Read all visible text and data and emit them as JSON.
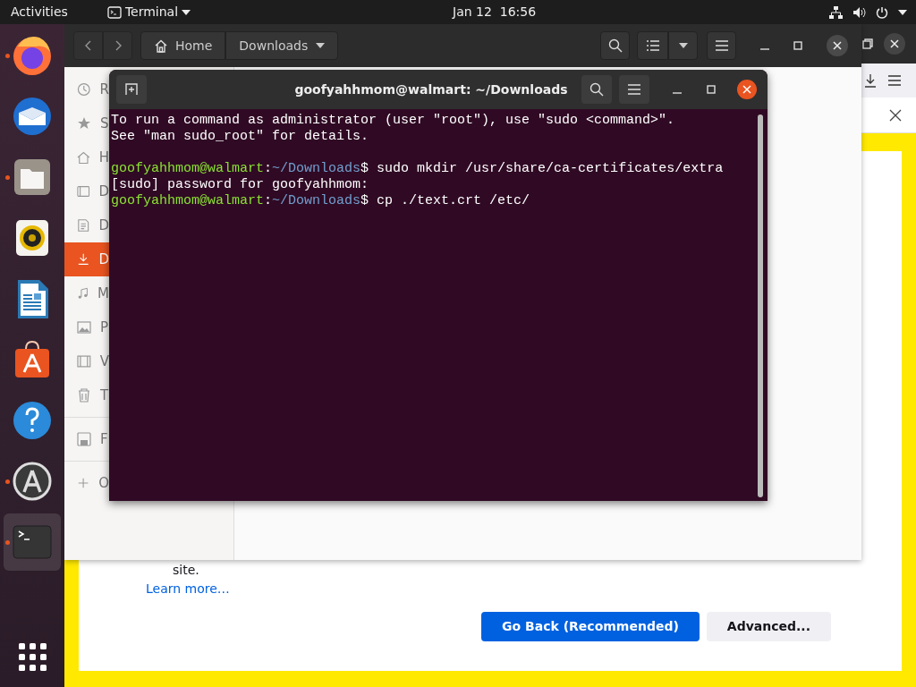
{
  "top_bar": {
    "activities": "Activities",
    "app_menu": "Terminal",
    "clock": "Jan 12  16:56"
  },
  "dock": [
    {
      "kind": "firefox",
      "running": true,
      "selected": false
    },
    {
      "kind": "mail",
      "running": false,
      "selected": false
    },
    {
      "kind": "files",
      "running": true,
      "selected": false
    },
    {
      "kind": "music",
      "running": false,
      "selected": false
    },
    {
      "kind": "writer",
      "running": false,
      "selected": false
    },
    {
      "kind": "store",
      "running": false,
      "selected": false
    },
    {
      "kind": "help",
      "running": false,
      "selected": false
    },
    {
      "kind": "updater",
      "running": true,
      "selected": false
    },
    {
      "kind": "terminal",
      "running": true,
      "selected": true
    }
  ],
  "browser": {
    "partial_text": "site.",
    "link": "Learn more…",
    "buttons": [
      {
        "label": "Go Back (Recommended)",
        "primary": true
      },
      {
        "label": "Advanced...",
        "primary": false
      }
    ]
  },
  "files": {
    "path": [
      {
        "label": "Home",
        "kind": "home"
      },
      {
        "label": "Downloads",
        "kind": "current"
      }
    ],
    "sidebar": [
      {
        "label": "R",
        "kind": "recent",
        "selected": false
      },
      {
        "label": "S",
        "kind": "starred",
        "selected": false
      },
      {
        "label": "H",
        "kind": "home",
        "selected": false
      },
      {
        "label": "D",
        "kind": "desktop",
        "selected": false
      },
      {
        "label": "D",
        "kind": "documents",
        "selected": false
      },
      {
        "label": "D",
        "kind": "downloads",
        "selected": true
      },
      {
        "label": "M",
        "kind": "music",
        "selected": false
      },
      {
        "label": "P",
        "kind": "pictures",
        "selected": false
      },
      {
        "label": "V",
        "kind": "videos",
        "selected": false
      },
      {
        "label": "T",
        "kind": "trash",
        "selected": false
      },
      {
        "label": "F",
        "kind": "floppy",
        "selected": false,
        "divider_before": true
      },
      {
        "label": "O",
        "kind": "other",
        "selected": false,
        "divider_before": true
      }
    ]
  },
  "terminal": {
    "title": "goofyahhmom@walmart: ~/Downloads",
    "lines": [
      {
        "kind": "output",
        "text": "To run a command as administrator (user \"root\"), use \"sudo <command>\"."
      },
      {
        "kind": "output",
        "text": "See \"man sudo_root\" for details."
      },
      {
        "kind": "prompt",
        "gap_before": true,
        "user": "goofyahhmom@walmart",
        "sep": ":",
        "path": "~/Downloads",
        "command": "$ sudo mkdir /usr/share/ca-certificates/extra"
      },
      {
        "kind": "output",
        "text": "[sudo] password for goofyahhmom:"
      },
      {
        "kind": "prompt",
        "user": "goofyahhmom@walmart",
        "sep": ":",
        "path": "~/Downloads",
        "command": "$ cp ./text.crt /etc/"
      }
    ]
  }
}
